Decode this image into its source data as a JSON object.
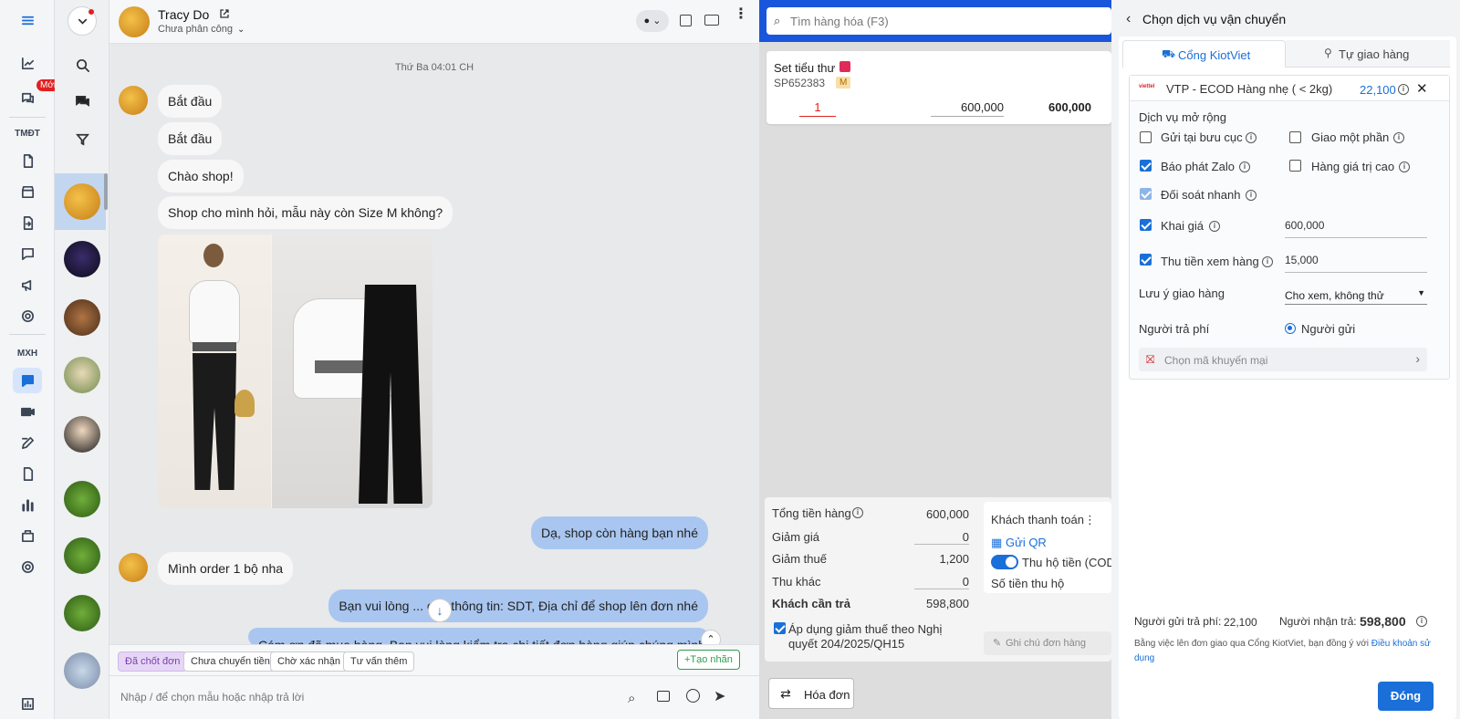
{
  "rail": {
    "sections": [
      "TMĐT",
      "MXH"
    ],
    "new_badge": "Mới"
  },
  "chat": {
    "contact_name": "Tracy Do",
    "assign_status": "Chưa phân công",
    "date_divider": "Thứ Ba 04:01 CH",
    "messages_in": [
      "Bắt đầu",
      "Bắt đầu",
      "Chào shop!",
      "Shop cho mình hỏi, mẫu này còn Size M không?",
      "Mình order 1 bộ nha"
    ],
    "messages_out": [
      "Dạ, shop còn hàng bạn nhé",
      "Bạn vui lòng ... cấp thông tin: SDT, Địa chỉ để shop lên đơn nhé",
      "Cám ơn đã mua hàng. Bạn vui lòng kiểm tra chi tiết đơn hàng giúp chúng mình nhé"
    ],
    "tags": [
      "Đã chốt đơn",
      "Chưa chuyển tiền",
      "Chờ xác nhận",
      "Tư vấn thêm"
    ],
    "create_tag": "+Tạo nhãn",
    "composer_placeholder": "Nhập / để chọn mẫu hoặc nhập trả lời"
  },
  "order": {
    "search_placeholder": "Tìm hàng hóa (F3)",
    "product_name": "Set tiểu thư",
    "sku": "SP652383",
    "unit": "M",
    "qty": "1",
    "price": "600,000",
    "line_total": "600,000",
    "summary": {
      "total_label": "Tổng tiền hàng",
      "total": "600,000",
      "discount_label": "Giảm giá",
      "discount": "0",
      "tax_cut_label": "Giảm thuế",
      "tax_cut": "1,200",
      "other_label": "Thu khác",
      "other": "0",
      "customer_pay_label": "Khách cần trả",
      "customer_pay": "598,800"
    },
    "apply_tax": "Áp dụng giảm thuế theo Nghị quyết 204/2025/QH15",
    "customer_paid_label": "Khách thanh toán",
    "send_qr": "Gửi QR",
    "cod_label": "Thu hộ tiền (COD",
    "cod_amount_label": "Số tiền thu hộ",
    "note_placeholder": "Ghi chú đơn hàng",
    "invoice_button": "Hóa đơn"
  },
  "panel": {
    "title": "Chọn dịch vụ vận chuyển",
    "tabs": [
      "Cổng KiotViet",
      "Tự giao hàng"
    ],
    "service_logo": "viettel",
    "service_name": "VTP - ECOD Hàng nhẹ ( < 2kg)",
    "service_price": "22,100",
    "ext_title": "Dịch vụ mở rộng",
    "options": {
      "post_office": "Gửi tại bưu cục",
      "partial": "Giao một phần",
      "zalo": "Báo phát Zalo",
      "high_value": "Hàng giá trị cao",
      "fast_recon": "Đối soát nhanh",
      "declare": "Khai giá",
      "declare_value": "600,000",
      "view_fee": "Thu tiền xem hàng",
      "view_fee_value": "15,000"
    },
    "note_label": "Lưu ý giao hàng",
    "note_value": "Cho xem, không thử",
    "payer_label": "Người trả phí",
    "payer_value": "Người gửi",
    "promo": "Chọn mã khuyến mại",
    "sender_fee_label": "Người gửi trả phí:",
    "sender_fee": "22,100",
    "receiver_pay_label": "Người nhận trả:",
    "receiver_pay": "598,800",
    "terms_text": "Bằng việc lên đơn giao qua Cổng KiotViet, bạn đồng ý với ",
    "terms_link": "Điều khoản sử dụng",
    "close_button": "Đóng"
  },
  "colors": {
    "accent": "#1a6fd8",
    "bubble_out": "#a9c6f0",
    "order_header": "#1a56db"
  }
}
